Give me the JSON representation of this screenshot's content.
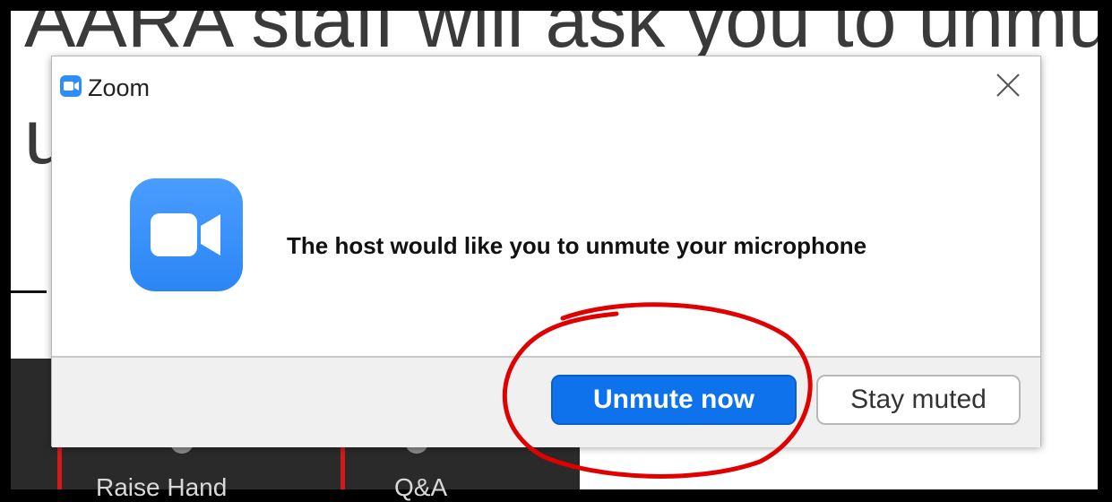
{
  "background": {
    "slide_line1": "AARA staff will ask you to unmute",
    "slide_line2": "u",
    "toolbar": {
      "items": [
        {
          "label": "Raise Hand"
        },
        {
          "label": "Q&A"
        }
      ]
    }
  },
  "dialog": {
    "title": "Zoom",
    "icon": "zoom-camera-icon",
    "message": "The host would like you to unmute your microphone",
    "primary_button": "Unmute now",
    "secondary_button": "Stay muted",
    "close_icon": "close-icon"
  },
  "annotation": {
    "type": "hand-drawn red circle around primary button",
    "color": "#e00000"
  },
  "colors": {
    "accent": "#0e72ed",
    "zoom_blue": "#2d8cff",
    "annotation_red": "#e00000"
  }
}
